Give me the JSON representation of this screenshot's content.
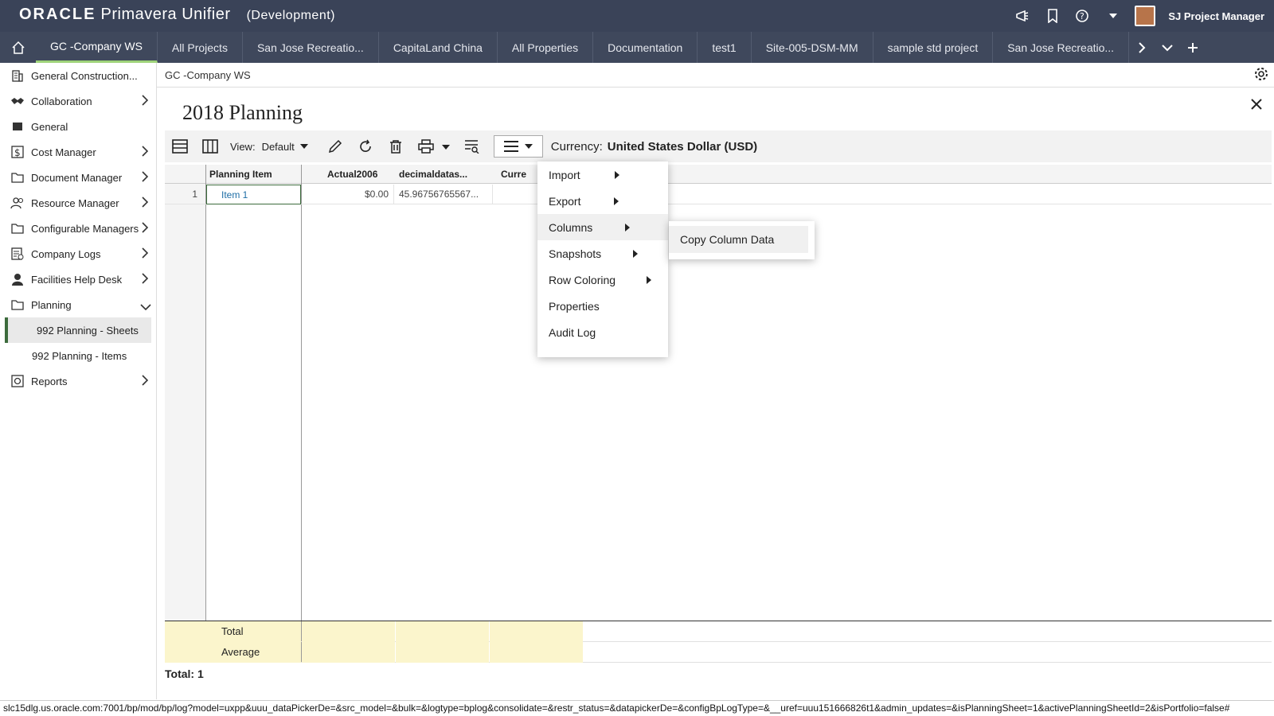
{
  "app": {
    "brand_oracle": "ORACLE",
    "brand_product": "Primavera Unifier",
    "environment": "(Development)",
    "user_name": "SJ Project Manager"
  },
  "tabs": [
    "GC -Company WS",
    "All Projects",
    "San Jose Recreatio...",
    "CapitaLand China",
    "All Properties",
    "Documentation",
    "test1",
    "Site-005-DSM-MM",
    "sample std project",
    "San Jose Recreatio..."
  ],
  "sidebar": {
    "items": [
      {
        "label": "General Construction...",
        "icon": "building-icon",
        "chevron": false
      },
      {
        "label": "Collaboration",
        "icon": "handshake-icon",
        "chevron": true
      },
      {
        "label": "General",
        "icon": "folder-filled-icon",
        "chevron": false
      },
      {
        "label": "Cost Manager",
        "icon": "dollar-icon",
        "chevron": true
      },
      {
        "label": "Document Manager",
        "icon": "folder-icon",
        "chevron": true
      },
      {
        "label": "Resource Manager",
        "icon": "people-icon",
        "chevron": true
      },
      {
        "label": "Configurable Managers",
        "icon": "folder-icon",
        "chevron": true
      },
      {
        "label": "Company Logs",
        "icon": "log-icon",
        "chevron": true
      },
      {
        "label": "Facilities Help Desk",
        "icon": "person-icon",
        "chevron": true
      },
      {
        "label": "Planning",
        "icon": "folder-icon",
        "chevron": "down"
      }
    ],
    "sub_items": [
      "992 Planning - Sheets",
      "992 Planning - Items"
    ],
    "reports": "Reports"
  },
  "main": {
    "breadcrumb": "GC -Company WS",
    "title": "2018 Planning",
    "view_label": "View:",
    "view_value": "Default",
    "currency_label": "Currency:",
    "currency_value": "United States Dollar (USD)"
  },
  "grid": {
    "columns": [
      "Planning Item",
      "Actual2006",
      "decimaldatas...",
      "Curre"
    ],
    "rows": [
      {
        "num": "1",
        "item": "Item 1",
        "actual": "$0.00",
        "decimal": "45.96756765567..."
      }
    ],
    "totals": [
      "Total",
      "Average"
    ],
    "total_count": "Total: 1"
  },
  "menu": {
    "items": [
      {
        "label": "Import",
        "submenu": true
      },
      {
        "label": "Export",
        "submenu": true
      },
      {
        "label": "Columns",
        "submenu": true
      },
      {
        "label": "Snapshots",
        "submenu": true
      },
      {
        "label": "Row Coloring",
        "submenu": true
      },
      {
        "label": "Properties",
        "submenu": false
      },
      {
        "label": "Audit Log",
        "submenu": false
      }
    ],
    "submenu_item": "Copy Column Data"
  },
  "status_url": "slc15dlg.us.oracle.com:7001/bp/mod/bp/log?model=uxpp&uuu_dataPickerDe=&src_model=&bulk=&logtype=bplog&consolidate=&restr_status=&datapickerDe=&configBpLogType=&__uref=uuu151666826t1&admin_updates=&isPlanningSheet=1&activePlanningSheetId=2&isPortfolio=false#",
  "colors": {
    "topbar": "#3a4358",
    "tabbar": "#3f485c",
    "accent": "#9fd37a",
    "link": "#1f6ea6",
    "totals_bg": "#fbf5cc"
  }
}
